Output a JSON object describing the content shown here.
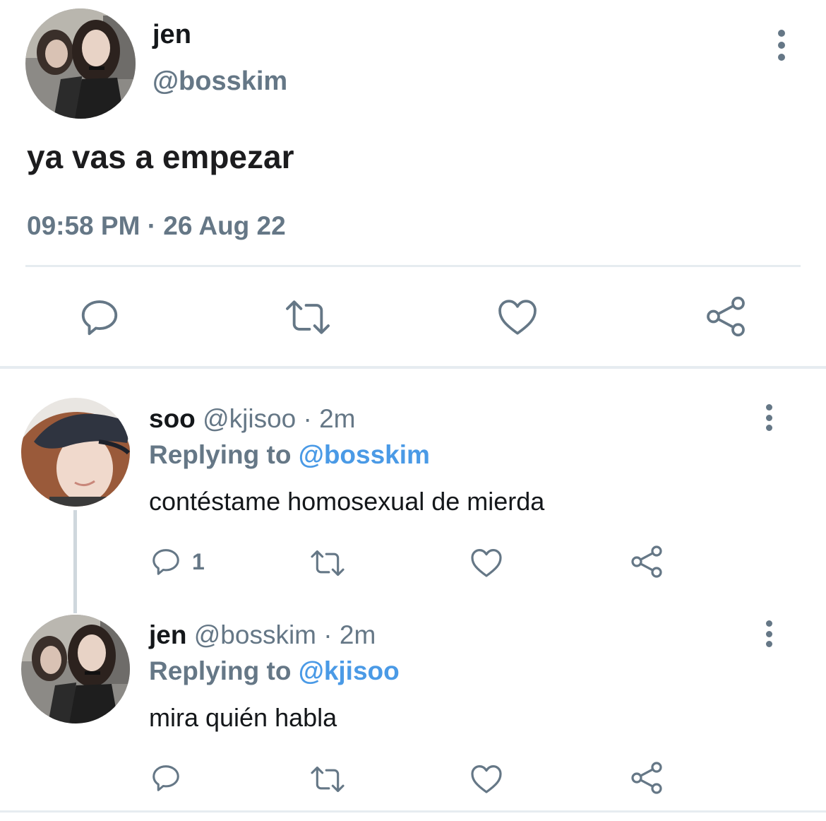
{
  "main_tweet": {
    "name": "jen",
    "handle": "@bosskim",
    "text": "ya vas a empezar",
    "timestamp": "09:58 PM · 26 Aug 22",
    "avatar": "avatar-photo",
    "actions": [
      "reply-icon",
      "retweet-icon",
      "like-icon",
      "share-icon"
    ]
  },
  "replies": [
    {
      "name": "soo",
      "handle": "@kjisoo",
      "sep": "·",
      "time": "2m",
      "replying_label": "Replying to",
      "replying_to": "@bosskim",
      "text": "contéstame homosexual de mierda",
      "reply_count": "1",
      "avatar": "avatar-photo"
    },
    {
      "name": "jen",
      "handle": "@bosskim",
      "sep": "·",
      "time": "2m",
      "replying_label": "Replying to",
      "replying_to": "@kjisoo",
      "text": "mira quién habla",
      "reply_count": "",
      "avatar": "avatar-photo"
    }
  ],
  "colors": {
    "primary_text": "#14171a",
    "secondary_text": "#657786",
    "mention": "#4a9ae6",
    "icon": "#657786",
    "divider": "#e6ecf0"
  }
}
